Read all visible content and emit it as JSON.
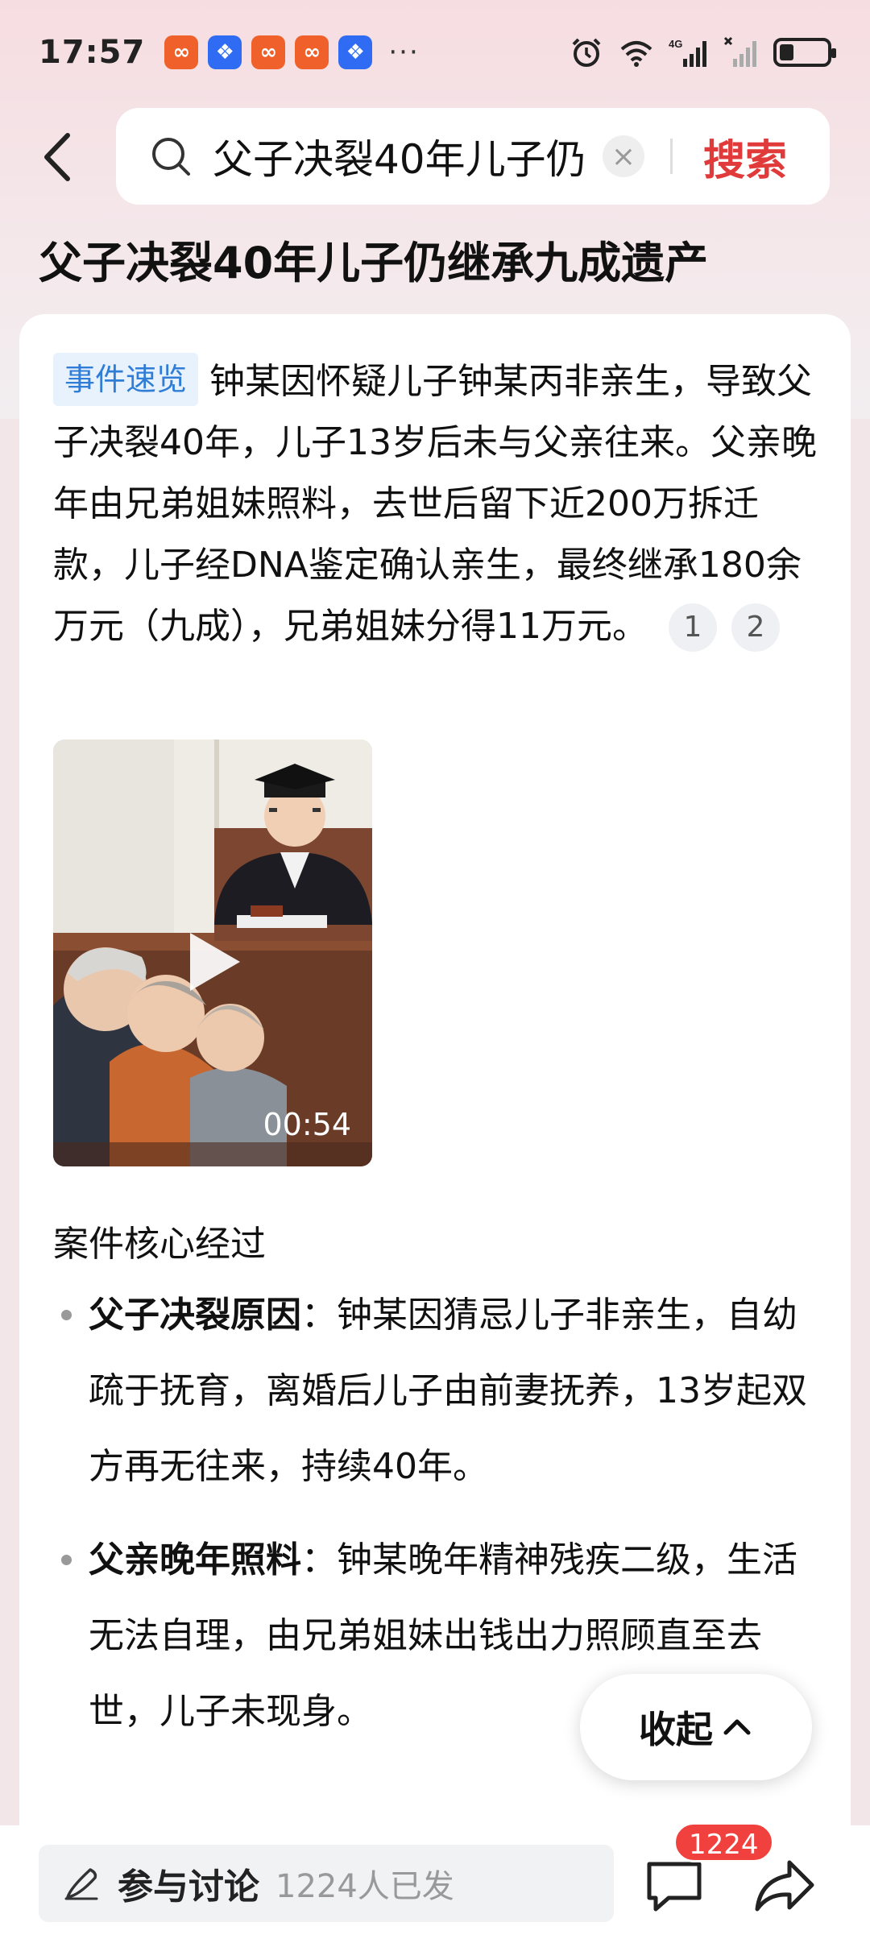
{
  "status_bar": {
    "time": "17:57",
    "more": "···",
    "network": "4G"
  },
  "search": {
    "query": "父子决裂40年儿子仍",
    "clear": "×",
    "button": "搜索"
  },
  "page": {
    "title": "父子决裂40年儿子仍继承九成遗产"
  },
  "summary": {
    "tag": "事件速览",
    "text": "钟某因怀疑儿子钟某丙非亲生，导致父子决裂40年，儿子13岁后未与父亲往来。父亲晚年由兄弟姐妹照料，去世后留下近200万拆迁款，儿子经DNA鉴定确认亲生，最终继承180余万元（九成），兄弟姐妹分得11万元。",
    "citations": [
      "1",
      "2"
    ]
  },
  "video": {
    "duration": "00:54"
  },
  "section": {
    "title": "案件核心经过",
    "items": [
      {
        "heading": "父子决裂原因",
        "sep": "：",
        "text": "钟某因猜忌儿子非亲生，自幼疏于抚育，离婚后儿子由前妻抚养，13岁起双方再无往来，持续40年。"
      },
      {
        "heading": "父亲晚年照料",
        "sep": "：",
        "text": "钟某晚年精神残疾二级，生活无法自理，由兄弟姐妹出钱出力照顾直至去世，儿子未现身。"
      }
    ]
  },
  "collapse": {
    "label": "收起"
  },
  "bottom_bar": {
    "discuss_label": "参与讨论",
    "discuss_count": "1224人已发",
    "comment_badge": "1224"
  },
  "colors": {
    "accent_red": "#e13a3a",
    "tag_blue": "#2f7dd6",
    "badge_red": "#f0413f"
  },
  "icons": {
    "back": "chevron-left-icon",
    "search": "search-icon",
    "play": "play-icon",
    "collapse": "chevron-up-icon",
    "pen": "pen-icon",
    "comment": "comment-icon",
    "share": "share-icon"
  }
}
